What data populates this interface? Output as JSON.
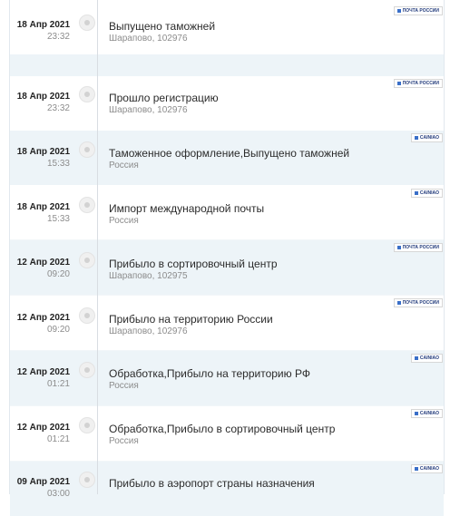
{
  "events": [
    {
      "date": "18 Апр 2021",
      "time": "23:32",
      "status": "Выпущено таможней",
      "location": "Шарапово, 102976",
      "carrier": "ПОЧТА РОССИИ"
    },
    {
      "date": "18 Апр 2021",
      "time": "23:32",
      "status": "Прошло регистрацию",
      "location": "Шарапово, 102976",
      "carrier": "ПОЧТА РОССИИ"
    },
    {
      "date": "18 Апр 2021",
      "time": "15:33",
      "status": "Таможенное оформление,Выпущено таможней",
      "location": "Россия",
      "carrier": "CAINIAO"
    },
    {
      "date": "18 Апр 2021",
      "time": "15:33",
      "status": "Импорт международной почты",
      "location": "Россия",
      "carrier": "CAINIAO"
    },
    {
      "date": "12 Апр 2021",
      "time": "09:20",
      "status": "Прибыло в сортировочный центр",
      "location": "Шарапово, 102975",
      "carrier": "ПОЧТА РОССИИ"
    },
    {
      "date": "12 Апр 2021",
      "time": "09:20",
      "status": "Прибыло на территорию России",
      "location": "Шарапово, 102976",
      "carrier": "ПОЧТА РОССИИ"
    },
    {
      "date": "12 Апр 2021",
      "time": "01:21",
      "status": "Обработка,Прибыло на территорию РФ",
      "location": "Россия",
      "carrier": "CAINIAO"
    },
    {
      "date": "12 Апр 2021",
      "time": "01:21",
      "status": "Обработка,Прибыло в сортировочный центр",
      "location": "Россия",
      "carrier": "CAINIAO"
    },
    {
      "date": "09 Апр 2021",
      "time": "03:00",
      "status": "Прибыло в аэропорт страны назначения",
      "location": "",
      "carrier": "CAINIAO"
    }
  ]
}
